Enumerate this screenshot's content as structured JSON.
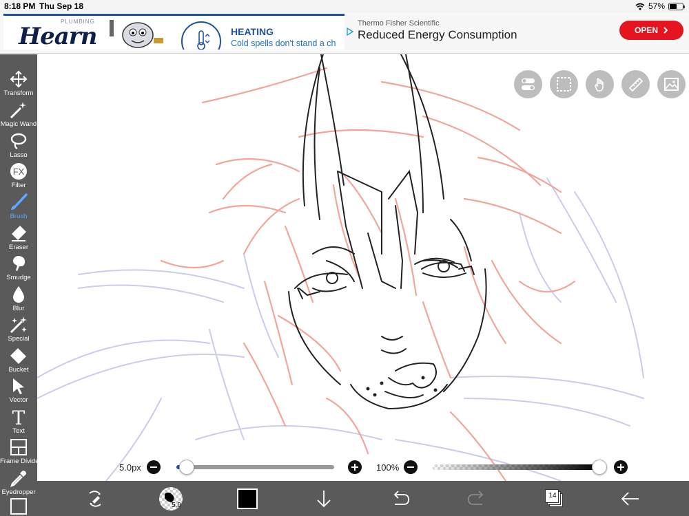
{
  "status_bar": {
    "time": "8:18 PM",
    "date": "Thu Sep 18",
    "battery": "57%",
    "battery_level": 0.57
  },
  "ad": {
    "logo_text": "Hearn",
    "logo_sub": "PLUMBING",
    "heading": "HEATING",
    "subtext": "Cold spells don't stand a ch",
    "sponsor": "Thermo Fisher Scientific",
    "headline": "Reduced Energy Consumption",
    "cta": "OPEN"
  },
  "tools": [
    {
      "id": "transform",
      "label": "Transform",
      "icon": "move-arrows-icon"
    },
    {
      "id": "magic-wand",
      "label": "Magic Wand",
      "icon": "magic-wand-icon"
    },
    {
      "id": "lasso",
      "label": "Lasso",
      "icon": "lasso-icon"
    },
    {
      "id": "filter",
      "label": "Filter",
      "icon": "fx-icon"
    },
    {
      "id": "brush",
      "label": "Brush",
      "icon": "brush-icon",
      "active": true
    },
    {
      "id": "eraser",
      "label": "Eraser",
      "icon": "eraser-icon"
    },
    {
      "id": "smudge",
      "label": "Smudge",
      "icon": "smudge-icon"
    },
    {
      "id": "blur",
      "label": "Blur",
      "icon": "droplet-icon"
    },
    {
      "id": "special",
      "label": "Special",
      "icon": "sparkle-icon"
    },
    {
      "id": "bucket",
      "label": "Bucket",
      "icon": "bucket-icon"
    },
    {
      "id": "vector",
      "label": "Vector",
      "icon": "cursor-icon"
    },
    {
      "id": "text",
      "label": "Text",
      "icon": "text-icon"
    },
    {
      "id": "frame-divider",
      "label": "Frame Divider",
      "icon": "frame-icon"
    },
    {
      "id": "eyedropper",
      "label": "Eyedropper",
      "icon": "eyedropper-icon"
    }
  ],
  "top_buttons": [
    "toggle-icon",
    "selection-icon",
    "hand-icon",
    "ruler-icon",
    "image-icon"
  ],
  "brush_size": {
    "label": "5.0px",
    "value": 0.03
  },
  "opacity": {
    "label": "100%",
    "value": 1.0
  },
  "bottom_bar": {
    "brush_number": "5.0",
    "color": "#000000",
    "layer_count": "14"
  },
  "colors": {
    "toolbar": "#5a5a5a",
    "accent": "#5aa9ff",
    "sketch_red": "#f2a59a",
    "sketch_blue": "#c9cde8",
    "ink": "#222222"
  }
}
